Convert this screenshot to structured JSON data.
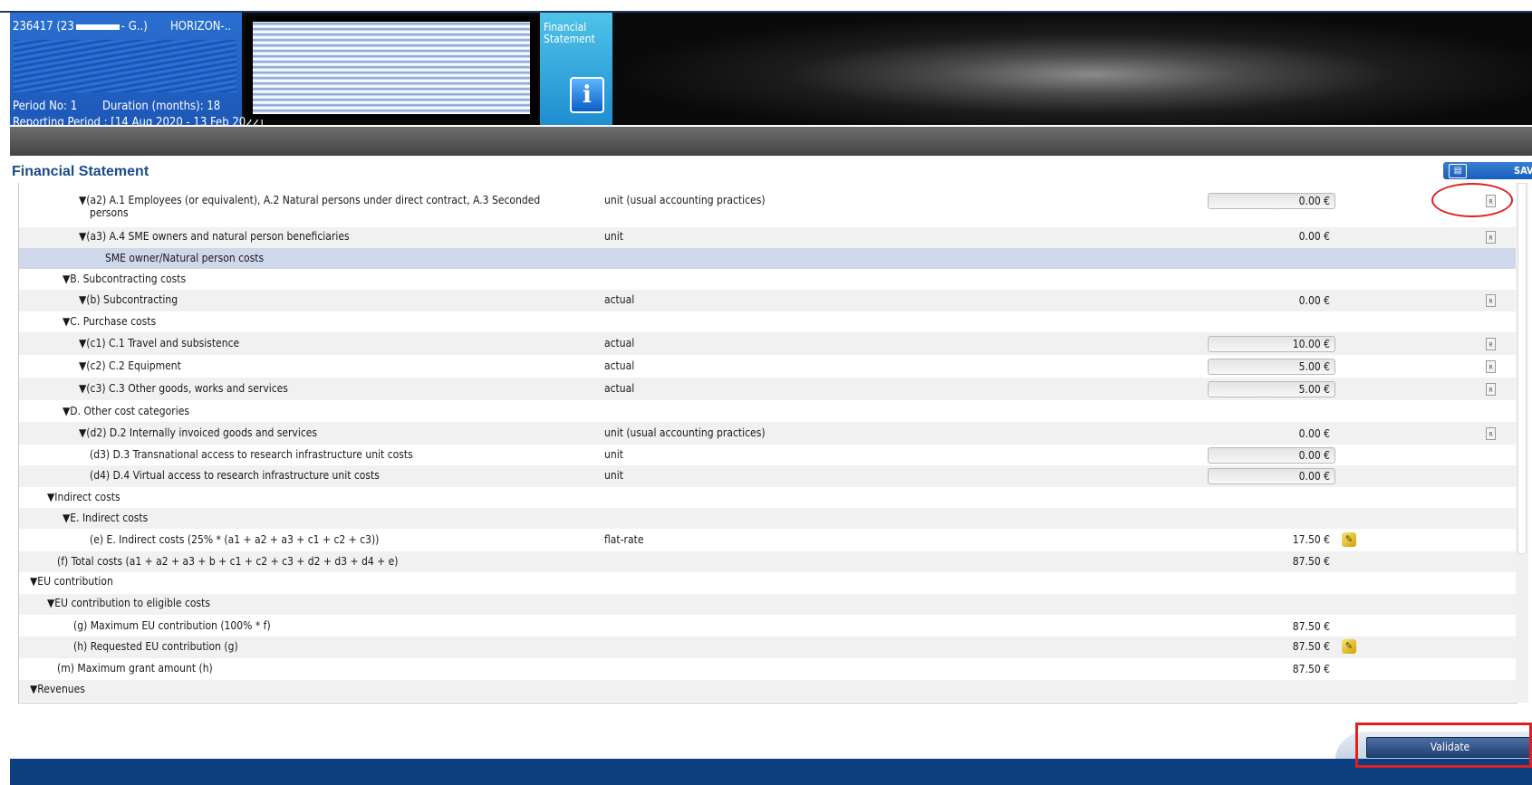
{
  "header": {
    "project_prefix": "236417 (23",
    "project_suffix": "- G..)",
    "programme": "HORIZON-..",
    "period_no": "Period No: 1",
    "duration": "Duration (months): 18",
    "reporting_period": "Reporting Period : [14 Aug 2020 - 13 Feb 2022]",
    "tab_label": "Financial Statement",
    "info_glyph": "i"
  },
  "page": {
    "title": "Financial Statement",
    "save_label": "SAV"
  },
  "rows": [
    {
      "label": "▼(a2) A.1 Employees (or equivalent), A.2 Natural persons under direct contract, A.3 Seconded",
      "label2": "persons",
      "type": "unit (usual accounting practices)",
      "amount": "0.00 €"
    },
    {
      "label": "▼(a3) A.4 SME owners and natural person beneficiaries",
      "type": "unit",
      "amount": "0.00 €"
    },
    {
      "label": "SME owner/Natural person costs"
    },
    {
      "label": "▼B. Subcontracting costs"
    },
    {
      "label": "▼(b) Subcontracting",
      "type": "actual",
      "amount": "0.00 €"
    },
    {
      "label": "▼C. Purchase costs"
    },
    {
      "label": "▼(c1) C.1 Travel and subsistence",
      "type": "actual",
      "amount": "10.00 €"
    },
    {
      "label": "▼(c2) C.2 Equipment",
      "type": "actual",
      "amount": "5.00 €"
    },
    {
      "label": "▼(c3) C.3 Other goods, works and services",
      "type": "actual",
      "amount": "5.00 €"
    },
    {
      "label": "▼D. Other cost categories"
    },
    {
      "label": "▼(d2) D.2 Internally invoiced goods and services",
      "type": "unit (usual accounting practices)",
      "amount": "0.00 €"
    },
    {
      "label": "(d3) D.3 Transnational access to research infrastructure unit costs",
      "type": "unit",
      "amount": "0.00 €"
    },
    {
      "label": "(d4) D.4 Virtual access to research infrastructure unit costs",
      "type": "unit",
      "amount": "0.00 €"
    },
    {
      "label": "▼Indirect costs"
    },
    {
      "label": "▼E. Indirect costs"
    },
    {
      "label": "(e) E. Indirect costs (25% * (a1 + a2 + a3 + c1 + c2 + c3))",
      "type": "flat-rate",
      "amount": "17.50 €"
    },
    {
      "label": "(f) Total costs (a1 + a2 + a3 + b + c1 + c2 + c3 + d2 + d3 + d4 + e)",
      "amount": "87.50 €"
    },
    {
      "label": "▼EU contribution"
    },
    {
      "label": "▼EU contribution to eligible costs"
    },
    {
      "label": "(g) Maximum EU contribution (100% * f)",
      "amount": "87.50 €"
    },
    {
      "label": "(h) Requested EU contribution (g)",
      "amount": "87.50 €"
    },
    {
      "label": "(m) Maximum grant amount (h)",
      "amount": "87.50 €"
    },
    {
      "label": "▼Revenues"
    }
  ],
  "footer": {
    "validate_label": "Validate"
  },
  "icons": {
    "report": "document-icon",
    "edit": "edit-pencil-icon",
    "save": "save-icon",
    "info": "info-icon"
  },
  "colors": {
    "title_blue": "#1b4b8a",
    "highlight_row": "#cfd8ea",
    "annotation_red": "#e02020",
    "footer_blue": "#0d3f80"
  }
}
